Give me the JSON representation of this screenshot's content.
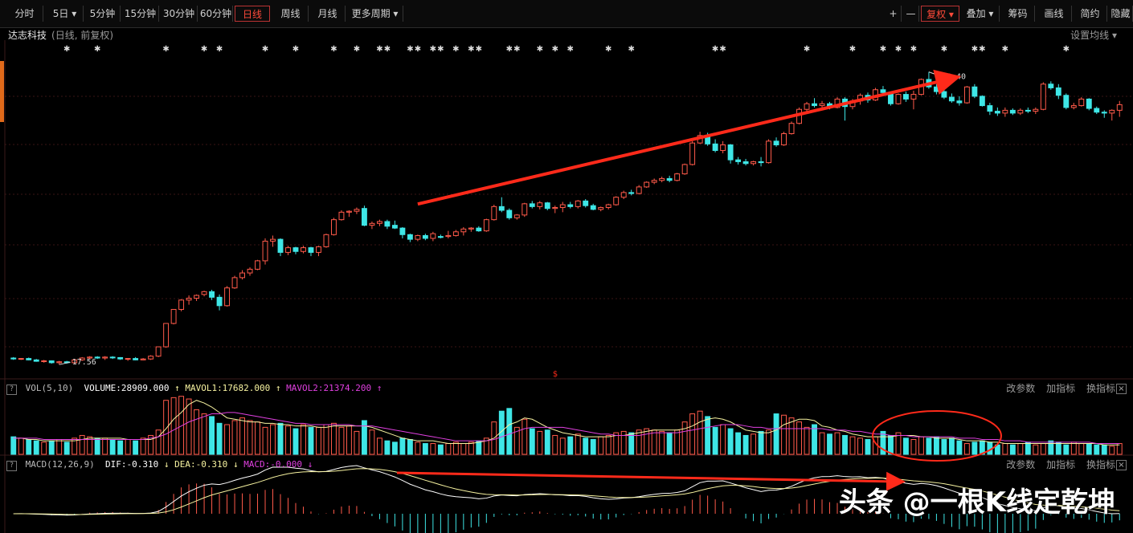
{
  "toolbar": {
    "left_tabs": [
      "分时",
      "5日 ▾",
      "5分钟",
      "15分钟",
      "30分钟",
      "60分钟",
      "日线",
      "周线",
      "月线",
      "更多周期 ▾"
    ],
    "active_index": 6,
    "right_tools": [
      "+",
      "—",
      "复权 ▾",
      "叠加 ▾",
      "筹码",
      "画线",
      "简约",
      "隐藏"
    ]
  },
  "stock": {
    "name": "达志科技",
    "mode": "(日线, 前复权)"
  },
  "ma_setting_label": "设置均线 ▾",
  "vol_header": {
    "name": "VOL(5,10)",
    "volume": "VOLUME:28909.000",
    "mavol1": "MAVOL1:17682.000",
    "mavol2": "MAVOL2:21374.200"
  },
  "macd_header": {
    "name": "MACD(12,26,9)",
    "dif": "DIF:-0.310",
    "dea": "DEA:-0.310",
    "macd": "MACD:-0.000"
  },
  "panel_tools": [
    "改参数",
    "加指标",
    "换指标"
  ],
  "close_symbol": "×",
  "question_symbol": "?",
  "watermark": "头条 @一根K线定乾坤",
  "colors": {
    "up": "#ff5a4a",
    "down": "#3ee6e6",
    "ma1": "#f7f3a0",
    "ma2": "#e040e0",
    "annotation": "#ff2a1a"
  },
  "chart_data": {
    "type": "candlestick",
    "low_label": "17.56",
    "high_label": "48.40",
    "ohlc": [
      [
        17.8,
        17.9,
        17.6,
        17.7
      ],
      [
        17.7,
        17.8,
        17.6,
        17.75
      ],
      [
        17.75,
        17.85,
        17.55,
        17.6
      ],
      [
        17.6,
        17.7,
        17.4,
        17.45
      ],
      [
        17.45,
        17.6,
        17.3,
        17.5
      ],
      [
        17.5,
        17.55,
        17.2,
        17.3
      ],
      [
        17.3,
        17.5,
        17.1,
        17.4
      ],
      [
        17.4,
        17.5,
        17.2,
        17.3
      ],
      [
        17.3,
        17.7,
        17.2,
        17.6
      ],
      [
        17.6,
        17.9,
        17.5,
        17.8
      ],
      [
        17.8,
        18.0,
        17.7,
        17.9
      ],
      [
        17.9,
        18.0,
        17.7,
        17.8
      ],
      [
        17.8,
        18.0,
        17.6,
        17.9
      ],
      [
        17.9,
        18.0,
        17.7,
        17.85
      ],
      [
        17.85,
        17.9,
        17.6,
        17.7
      ],
      [
        17.7,
        17.8,
        17.5,
        17.75
      ],
      [
        17.75,
        17.9,
        17.56,
        17.6
      ],
      [
        17.6,
        17.8,
        17.56,
        17.7
      ],
      [
        17.7,
        18.1,
        17.6,
        18.0
      ],
      [
        18.0,
        19.0,
        17.9,
        19.0
      ],
      [
        19.0,
        21.5,
        18.9,
        21.5
      ],
      [
        21.5,
        23.0,
        21.4,
        23.0
      ],
      [
        23.0,
        24.1,
        22.8,
        24.0
      ],
      [
        24.0,
        24.5,
        23.5,
        24.2
      ],
      [
        24.2,
        24.6,
        23.9,
        24.5
      ],
      [
        24.6,
        25.0,
        24.4,
        24.9
      ],
      [
        24.9,
        25.1,
        24.0,
        24.3
      ],
      [
        24.3,
        24.6,
        22.9,
        23.4
      ],
      [
        23.4,
        25.5,
        23.3,
        25.3
      ],
      [
        25.3,
        26.6,
        25.2,
        26.4
      ],
      [
        26.4,
        27.2,
        26.2,
        26.9
      ],
      [
        26.9,
        27.5,
        26.6,
        27.3
      ],
      [
        27.3,
        28.3,
        27.2,
        28.2
      ],
      [
        28.2,
        30.6,
        27.8,
        30.3
      ],
      [
        30.3,
        30.9,
        29.7,
        30.5
      ],
      [
        30.5,
        30.6,
        28.7,
        29.1
      ],
      [
        29.1,
        29.8,
        28.8,
        29.6
      ],
      [
        29.6,
        29.7,
        28.9,
        29.2
      ],
      [
        29.2,
        29.8,
        29.0,
        29.6
      ],
      [
        29.6,
        29.7,
        28.7,
        29.1
      ],
      [
        29.1,
        29.8,
        28.7,
        29.7
      ],
      [
        29.7,
        31.1,
        29.6,
        31.0
      ],
      [
        31.0,
        32.8,
        30.9,
        32.6
      ],
      [
        32.6,
        33.6,
        32.5,
        33.4
      ],
      [
        33.4,
        33.6,
        32.9,
        33.5
      ],
      [
        33.5,
        33.9,
        33.2,
        33.7
      ],
      [
        33.8,
        34.1,
        31.9,
        32.0
      ],
      [
        32.0,
        32.4,
        31.6,
        32.2
      ],
      [
        32.2,
        32.6,
        31.9,
        32.4
      ],
      [
        32.4,
        32.6,
        31.6,
        31.9
      ],
      [
        32.0,
        32.5,
        31.6,
        31.7
      ],
      [
        31.7,
        31.8,
        30.6,
        31.0
      ],
      [
        31.0,
        31.1,
        30.2,
        30.5
      ],
      [
        30.5,
        31.0,
        30.3,
        30.9
      ],
      [
        30.9,
        31.1,
        30.4,
        30.6
      ],
      [
        30.6,
        31.3,
        30.3,
        31.1
      ],
      [
        30.8,
        31.0,
        30.6,
        30.7
      ],
      [
        30.8,
        31.4,
        30.6,
        30.9
      ],
      [
        30.9,
        31.5,
        30.8,
        31.3
      ],
      [
        31.3,
        31.8,
        30.9,
        31.6
      ],
      [
        31.6,
        31.8,
        31.3,
        31.7
      ],
      [
        31.7,
        31.9,
        31.3,
        31.4
      ],
      [
        31.4,
        32.7,
        31.3,
        32.6
      ],
      [
        32.6,
        34.2,
        32.5,
        34.0
      ],
      [
        34.0,
        35.0,
        33.4,
        33.6
      ],
      [
        33.6,
        33.8,
        32.6,
        32.8
      ],
      [
        32.8,
        33.2,
        32.6,
        33.1
      ],
      [
        33.1,
        34.4,
        32.9,
        34.3
      ],
      [
        34.3,
        34.6,
        33.8,
        34.0
      ],
      [
        34.0,
        34.6,
        33.7,
        34.4
      ],
      [
        34.4,
        34.5,
        33.6,
        33.8
      ],
      [
        33.8,
        34.1,
        33.3,
        33.9
      ],
      [
        33.9,
        34.5,
        33.4,
        34.2
      ],
      [
        34.2,
        34.5,
        33.8,
        34.0
      ],
      [
        34.0,
        34.7,
        33.8,
        34.6
      ],
      [
        34.6,
        34.8,
        33.9,
        34.1
      ],
      [
        34.1,
        34.3,
        33.6,
        33.7
      ],
      [
        33.7,
        34.0,
        33.5,
        33.9
      ],
      [
        33.9,
        34.3,
        33.7,
        34.2
      ],
      [
        34.2,
        35.1,
        34.1,
        35.0
      ],
      [
        35.0,
        35.7,
        34.8,
        35.5
      ],
      [
        35.5,
        35.8,
        35.2,
        35.4
      ],
      [
        35.4,
        36.3,
        35.3,
        36.1
      ],
      [
        36.1,
        36.7,
        36.0,
        36.6
      ],
      [
        36.6,
        37.0,
        36.4,
        36.8
      ],
      [
        36.8,
        37.2,
        36.6,
        37.0
      ],
      [
        37.0,
        37.3,
        36.6,
        36.8
      ],
      [
        36.8,
        37.6,
        36.7,
        37.5
      ],
      [
        37.5,
        38.6,
        37.4,
        38.5
      ],
      [
        38.5,
        41.0,
        38.4,
        40.8
      ],
      [
        40.8,
        42.0,
        40.7,
        41.6
      ],
      [
        41.6,
        41.9,
        40.5,
        40.7
      ],
      [
        40.7,
        41.2,
        39.8,
        40.0
      ],
      [
        40.0,
        41.0,
        39.7,
        40.6
      ],
      [
        40.6,
        40.7,
        38.6,
        39.0
      ],
      [
        39.0,
        39.3,
        38.5,
        38.8
      ],
      [
        38.8,
        39.1,
        38.4,
        38.6
      ],
      [
        38.6,
        38.9,
        38.4,
        38.8
      ],
      [
        38.8,
        39.3,
        38.3,
        38.7
      ],
      [
        38.7,
        41.2,
        38.6,
        41.0
      ],
      [
        41.0,
        41.4,
        40.4,
        40.6
      ],
      [
        40.6,
        42.0,
        40.5,
        41.8
      ],
      [
        41.8,
        43.1,
        41.7,
        42.9
      ],
      [
        42.9,
        44.6,
        42.8,
        44.4
      ],
      [
        44.4,
        45.2,
        44.1,
        45.0
      ],
      [
        45.0,
        45.6,
        44.6,
        44.8
      ],
      [
        44.8,
        45.3,
        44.3,
        45.0
      ],
      [
        45.0,
        45.2,
        44.4,
        44.6
      ],
      [
        44.6,
        45.7,
        44.5,
        45.5
      ],
      [
        45.5,
        45.7,
        43.2,
        44.7
      ],
      [
        44.7,
        45.5,
        44.4,
        45.3
      ],
      [
        45.3,
        46.1,
        44.9,
        45.9
      ],
      [
        45.9,
        46.2,
        45.1,
        45.4
      ],
      [
        45.4,
        46.7,
        45.3,
        46.5
      ],
      [
        46.5,
        46.9,
        45.9,
        46.2
      ],
      [
        46.2,
        46.3,
        44.8,
        45.0
      ],
      [
        45.0,
        46.1,
        44.9,
        46.0
      ],
      [
        46.0,
        46.3,
        45.2,
        45.5
      ],
      [
        45.5,
        46.4,
        44.4,
        46.0
      ],
      [
        46.0,
        47.7,
        45.9,
        47.6
      ],
      [
        47.6,
        48.4,
        46.6,
        46.8
      ],
      [
        46.8,
        47.1,
        46.0,
        46.3
      ],
      [
        46.3,
        46.6,
        45.5,
        45.7
      ],
      [
        45.7,
        46.1,
        45.1,
        45.3
      ],
      [
        45.3,
        45.8,
        44.8,
        45.1
      ],
      [
        45.1,
        46.9,
        45.0,
        46.8
      ],
      [
        46.8,
        47.1,
        45.6,
        45.8
      ],
      [
        45.8,
        45.9,
        44.7,
        44.8
      ],
      [
        44.8,
        45.1,
        43.8,
        44.2
      ],
      [
        44.2,
        44.6,
        43.7,
        44.0
      ],
      [
        44.0,
        44.6,
        43.6,
        44.3
      ],
      [
        44.3,
        44.5,
        43.8,
        44.0
      ],
      [
        44.0,
        44.5,
        43.8,
        44.3
      ],
      [
        44.3,
        44.6,
        44.0,
        44.2
      ],
      [
        44.2,
        44.6,
        43.9,
        44.4
      ],
      [
        44.4,
        47.3,
        44.3,
        47.1
      ],
      [
        47.1,
        47.4,
        46.5,
        46.7
      ],
      [
        46.7,
        47.1,
        45.5,
        45.9
      ],
      [
        45.9,
        46.1,
        44.4,
        44.6
      ],
      [
        44.6,
        45.1,
        44.4,
        44.8
      ],
      [
        44.8,
        45.7,
        44.7,
        45.5
      ],
      [
        45.5,
        45.6,
        44.3,
        44.5
      ],
      [
        44.5,
        44.7,
        43.9,
        44.1
      ],
      [
        44.1,
        44.3,
        43.5,
        44.0
      ],
      [
        44.0,
        44.4,
        43.2,
        44.3
      ],
      [
        44.3,
        45.3,
        43.6,
        44.9
      ]
    ],
    "volume": [
      13,
      12,
      11,
      10,
      9,
      10,
      11,
      9,
      12,
      14,
      13,
      12,
      12,
      11,
      10,
      11,
      10,
      12,
      14,
      18,
      40,
      42,
      43,
      41,
      33,
      30,
      28,
      23,
      22,
      25,
      27,
      25,
      24,
      20,
      22,
      23,
      21,
      19,
      22,
      20,
      20,
      22,
      23,
      20,
      21,
      17,
      25,
      18,
      12,
      10,
      9,
      12,
      11,
      9,
      8,
      8,
      7,
      8,
      9,
      8,
      9,
      10,
      12,
      24,
      32,
      34,
      20,
      26,
      19,
      17,
      18,
      14,
      12,
      13,
      15,
      12,
      11,
      13,
      14,
      16,
      17,
      16,
      18,
      19,
      18,
      17,
      16,
      18,
      24,
      30,
      32,
      28,
      20,
      22,
      19,
      16,
      14,
      15,
      17,
      18,
      30,
      29,
      27,
      24,
      20,
      22,
      16,
      15,
      16,
      14,
      13,
      12,
      11,
      13,
      17,
      14,
      16,
      12,
      11,
      13,
      12,
      13,
      11,
      12,
      10,
      8,
      9,
      10,
      9,
      7,
      8,
      7,
      8,
      9,
      7,
      8,
      10,
      9,
      7,
      9,
      8,
      8,
      7,
      7,
      6,
      8
    ],
    "mavol1": [
      12,
      12,
      11,
      11,
      10,
      10,
      10,
      10,
      10,
      11,
      12,
      12,
      12,
      12,
      12,
      11,
      11,
      11,
      11,
      13,
      19,
      26,
      31,
      37,
      40,
      38,
      35,
      31,
      27,
      26,
      25,
      24,
      24,
      23,
      23,
      22,
      22,
      21,
      21,
      21,
      20,
      20,
      21,
      21,
      21,
      21,
      21,
      20,
      18,
      16,
      14,
      12,
      11,
      10,
      10,
      10,
      9,
      8,
      8,
      8,
      8,
      9,
      10,
      12,
      17,
      22,
      24,
      27,
      26,
      23,
      20,
      18,
      16,
      15,
      14,
      13,
      13,
      13,
      13,
      14,
      14,
      15,
      16,
      17,
      18,
      18,
      18,
      18,
      19,
      21,
      24,
      26,
      27,
      26,
      24,
      21,
      18,
      17,
      16,
      16,
      18,
      22,
      24,
      26,
      26,
      25,
      21,
      20,
      18,
      17,
      15,
      14,
      13,
      13,
      13,
      13,
      14,
      14,
      14,
      13,
      13,
      12,
      12,
      12,
      11,
      10,
      10,
      10,
      9,
      9,
      8,
      8,
      8,
      8,
      8,
      8,
      8,
      8,
      8,
      8,
      8,
      8,
      8,
      7,
      7,
      7
    ],
    "mavol2": [
      12,
      12,
      12,
      12,
      11,
      11,
      11,
      11,
      11,
      11,
      11,
      11,
      11,
      11,
      11,
      11,
      11,
      11,
      12,
      13,
      15,
      18,
      21,
      24,
      26,
      28,
      30,
      30,
      31,
      31,
      30,
      29,
      28,
      27,
      26,
      25,
      24,
      23,
      23,
      22,
      22,
      22,
      22,
      22,
      22,
      21,
      21,
      21,
      20,
      19,
      18,
      17,
      16,
      15,
      14,
      13,
      12,
      11,
      10,
      10,
      10,
      10,
      10,
      11,
      13,
      15,
      17,
      19,
      20,
      20,
      20,
      20,
      20,
      19,
      18,
      17,
      16,
      15,
      15,
      14,
      14,
      14,
      14,
      15,
      16,
      16,
      16,
      16,
      17,
      18,
      19,
      20,
      21,
      22,
      22,
      22,
      21,
      20,
      20,
      19,
      19,
      19,
      19,
      19,
      19,
      19,
      19,
      18,
      18,
      18,
      17,
      17,
      16,
      15,
      15,
      14,
      14,
      14,
      13,
      13,
      13,
      13,
      13,
      13,
      12,
      12,
      12,
      11,
      11,
      11,
      10,
      10,
      10,
      9,
      9,
      9,
      9,
      9,
      9,
      9,
      9,
      9,
      8,
      8,
      8,
      8
    ],
    "annotations": [
      "arrow-up-trend",
      "arrow-flat-macd",
      "volume-circle"
    ]
  }
}
